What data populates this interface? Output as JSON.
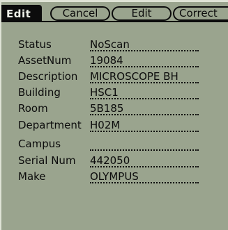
{
  "header": {
    "title": "Edit",
    "buttons": {
      "cancel": "Cancel",
      "edit": "Edit",
      "correct": "Correct"
    }
  },
  "fields": [
    {
      "label": "Status",
      "value": "NoScan"
    },
    {
      "label": "AssetNum",
      "value": "19084"
    },
    {
      "label": "Description",
      "value": "MICROSCOPE BH"
    },
    {
      "label": "Building",
      "value": "HSC1"
    },
    {
      "label": "Room",
      "value": "5B185"
    },
    {
      "label": "Department",
      "value": "H02M"
    },
    {
      "label": "Campus",
      "value": ""
    },
    {
      "label": "Serial Num",
      "value": "442050"
    },
    {
      "label": "Make",
      "value": "OLYMPUS"
    }
  ],
  "colors": {
    "screen_background": "#9aa48e",
    "ink": "#0c0c0c",
    "title_text": "#eef0e8"
  }
}
